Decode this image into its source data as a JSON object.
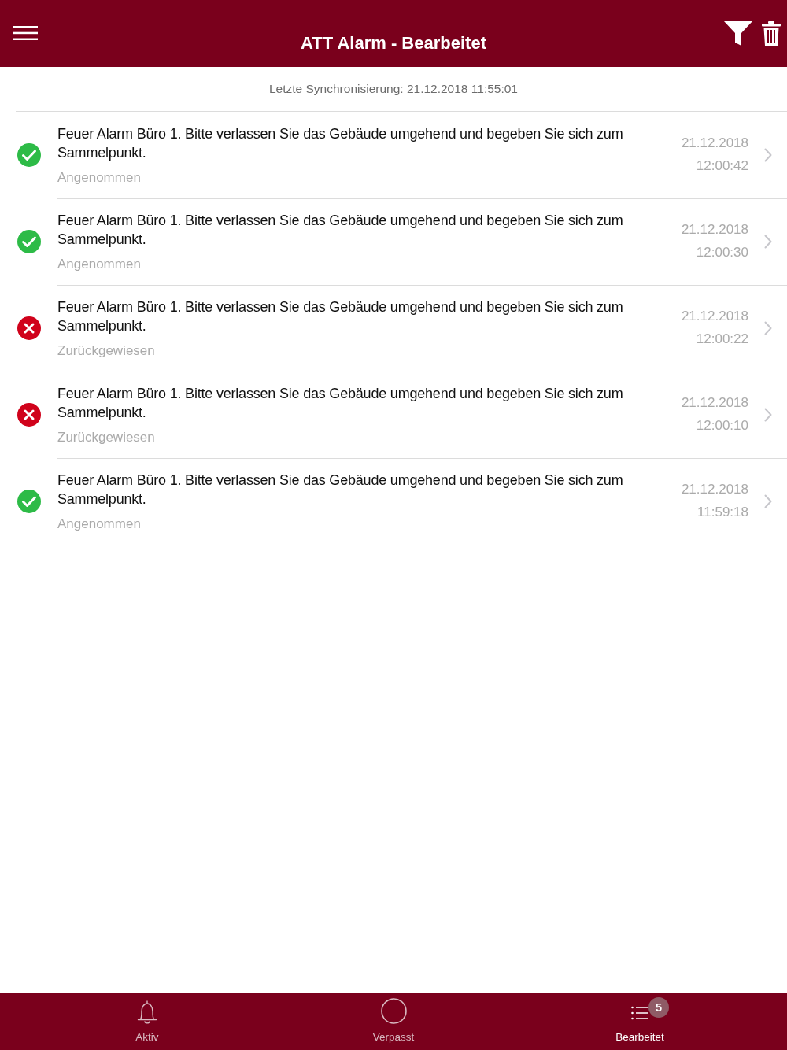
{
  "header": {
    "title": "ATT Alarm - Bearbeitet"
  },
  "sync_status": "Letzte Synchronisierung: 21.12.2018 11:55:01",
  "alarms": [
    {
      "kind": "accepted",
      "message": "Feuer Alarm Büro 1. Bitte verlassen Sie das Gebäude umgehend und begeben Sie sich zum Sammelpunkt.",
      "status": "Angenommen",
      "date": "21.12.2018",
      "time": "12:00:42"
    },
    {
      "kind": "accepted",
      "message": "Feuer Alarm Büro 1. Bitte verlassen Sie das Gebäude umgehend und begeben Sie sich zum Sammelpunkt.",
      "status": "Angenommen",
      "date": "21.12.2018",
      "time": "12:00:30"
    },
    {
      "kind": "rejected",
      "message": "Feuer Alarm Büro 1. Bitte verlassen Sie das Gebäude umgehend und begeben Sie sich zum Sammelpunkt.",
      "status": "Zurückgewiesen",
      "date": "21.12.2018",
      "time": "12:00:22"
    },
    {
      "kind": "rejected",
      "message": "Feuer Alarm Büro 1. Bitte verlassen Sie das Gebäude umgehend und begeben Sie sich zum Sammelpunkt.",
      "status": "Zurückgewiesen",
      "date": "21.12.2018",
      "time": "12:00:10"
    },
    {
      "kind": "accepted",
      "message": "Feuer Alarm Büro 1. Bitte verlassen Sie das Gebäude umgehend und begeben Sie sich zum Sammelpunkt.",
      "status": "Angenommen",
      "date": "21.12.2018",
      "time": "11:59:18"
    }
  ],
  "tab_bar": {
    "tabs": [
      {
        "kind": "bell",
        "label": "Aktiv",
        "selected": false
      },
      {
        "kind": "circle",
        "label": "Verpasst",
        "selected": false
      },
      {
        "kind": "list",
        "label": "Bearbeitet",
        "selected": true,
        "badge": "5"
      }
    ]
  }
}
